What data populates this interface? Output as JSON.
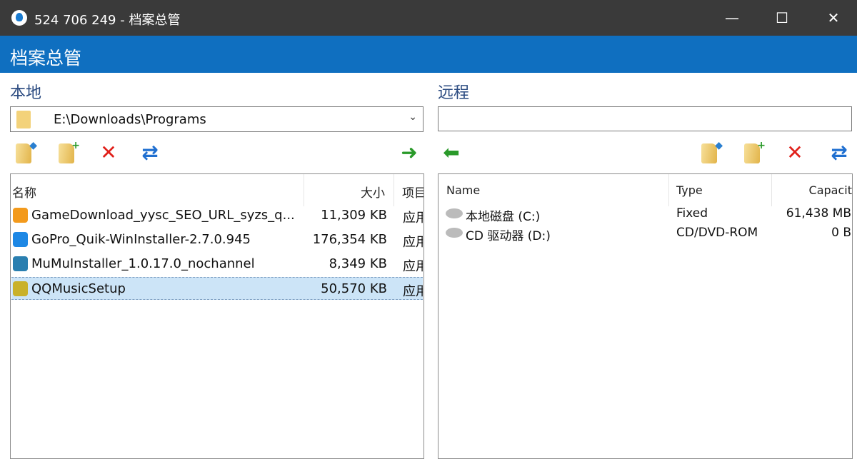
{
  "window": {
    "title": "524 706 249 - 档案总管",
    "minimize": "—",
    "maximize": "☐",
    "close": "✕"
  },
  "header": {
    "title": "档案总管"
  },
  "local": {
    "label": "本地",
    "path": "E:\\Downloads\\Programs",
    "toolbar": {
      "up": "up-folder",
      "new_folder": "new-folder",
      "delete": "✕",
      "refresh": "⇄",
      "transfer": "➜"
    },
    "columns": {
      "name": "名称",
      "size": "大小",
      "type": "项目"
    },
    "sort_indicator": "^",
    "files": [
      {
        "name": "GameDownload_yysc_SEO_URL_syzs_q...",
        "size": "11,309 KB",
        "type": "应用",
        "icon_color": "#f39a1c"
      },
      {
        "name": "GoPro_Quik-WinInstaller-2.7.0.945",
        "size": "176,354 KB",
        "type": "应用",
        "icon_color": "#1e88e5"
      },
      {
        "name": "MuMuInstaller_1.0.17.0_nochannel",
        "size": "8,349 KB",
        "type": "应用",
        "icon_color": "#2a7fb0"
      },
      {
        "name": "QQMusicSetup",
        "size": "50,570 KB",
        "type": "应用",
        "icon_color": "#c9b12a",
        "selected": true
      }
    ]
  },
  "remote": {
    "label": "远程",
    "path": "",
    "toolbar": {
      "transfer": "⬅",
      "delete": "✕",
      "refresh": "⇄"
    },
    "columns": {
      "name": "Name",
      "type": "Type",
      "capacity": "Capacit"
    },
    "drives": [
      {
        "name": "本地磁盘 (C:)",
        "type": "Fixed",
        "capacity": "61,438 MB"
      },
      {
        "name": "CD 驱动器 (D:)",
        "type": "CD/DVD-ROM",
        "capacity": "0 B"
      }
    ]
  }
}
